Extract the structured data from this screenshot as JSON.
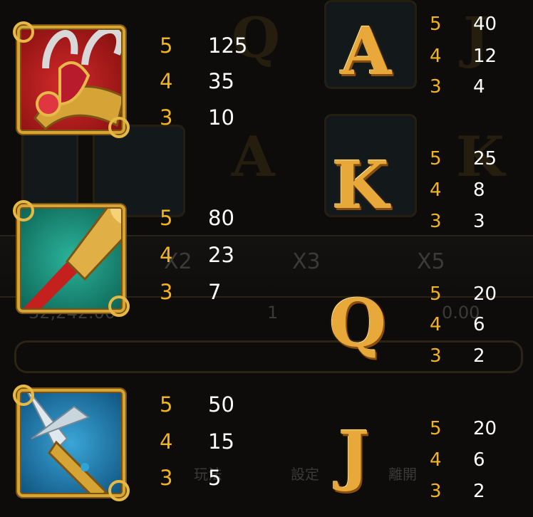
{
  "background": {
    "letters": [
      "Q",
      "A",
      "K",
      "J"
    ],
    "multipliers": [
      "X2",
      "X3",
      "X5"
    ],
    "balance": "32,242.00",
    "bet": "1",
    "win": "0.00",
    "menu": [
      "玩法",
      "設定",
      "離開"
    ]
  },
  "high_symbols": [
    {
      "name": "phoenix-crown",
      "pays": [
        {
          "count": "5",
          "value": "125"
        },
        {
          "count": "4",
          "value": "35"
        },
        {
          "count": "3",
          "value": "10"
        }
      ]
    },
    {
      "name": "golden-staff",
      "pays": [
        {
          "count": "5",
          "value": "80"
        },
        {
          "count": "4",
          "value": "23"
        },
        {
          "count": "3",
          "value": "7"
        }
      ]
    },
    {
      "name": "spear-blade",
      "pays": [
        {
          "count": "5",
          "value": "50"
        },
        {
          "count": "4",
          "value": "15"
        },
        {
          "count": "3",
          "value": "5"
        }
      ]
    }
  ],
  "low_symbols": [
    {
      "letter": "A",
      "pays": [
        {
          "count": "5",
          "value": "40"
        },
        {
          "count": "4",
          "value": "12"
        },
        {
          "count": "3",
          "value": "4"
        }
      ]
    },
    {
      "letter": "K",
      "pays": [
        {
          "count": "5",
          "value": "25"
        },
        {
          "count": "4",
          "value": "8"
        },
        {
          "count": "3",
          "value": "3"
        }
      ]
    },
    {
      "letter": "Q",
      "pays": [
        {
          "count": "5",
          "value": "20"
        },
        {
          "count": "4",
          "value": "6"
        },
        {
          "count": "3",
          "value": "2"
        }
      ]
    },
    {
      "letter": "J",
      "pays": [
        {
          "count": "5",
          "value": "20"
        },
        {
          "count": "4",
          "value": "6"
        },
        {
          "count": "3",
          "value": "2"
        }
      ]
    }
  ],
  "colors": {
    "count": "#f2b31b",
    "value": "#ffffff",
    "gold": "#d8a534"
  }
}
